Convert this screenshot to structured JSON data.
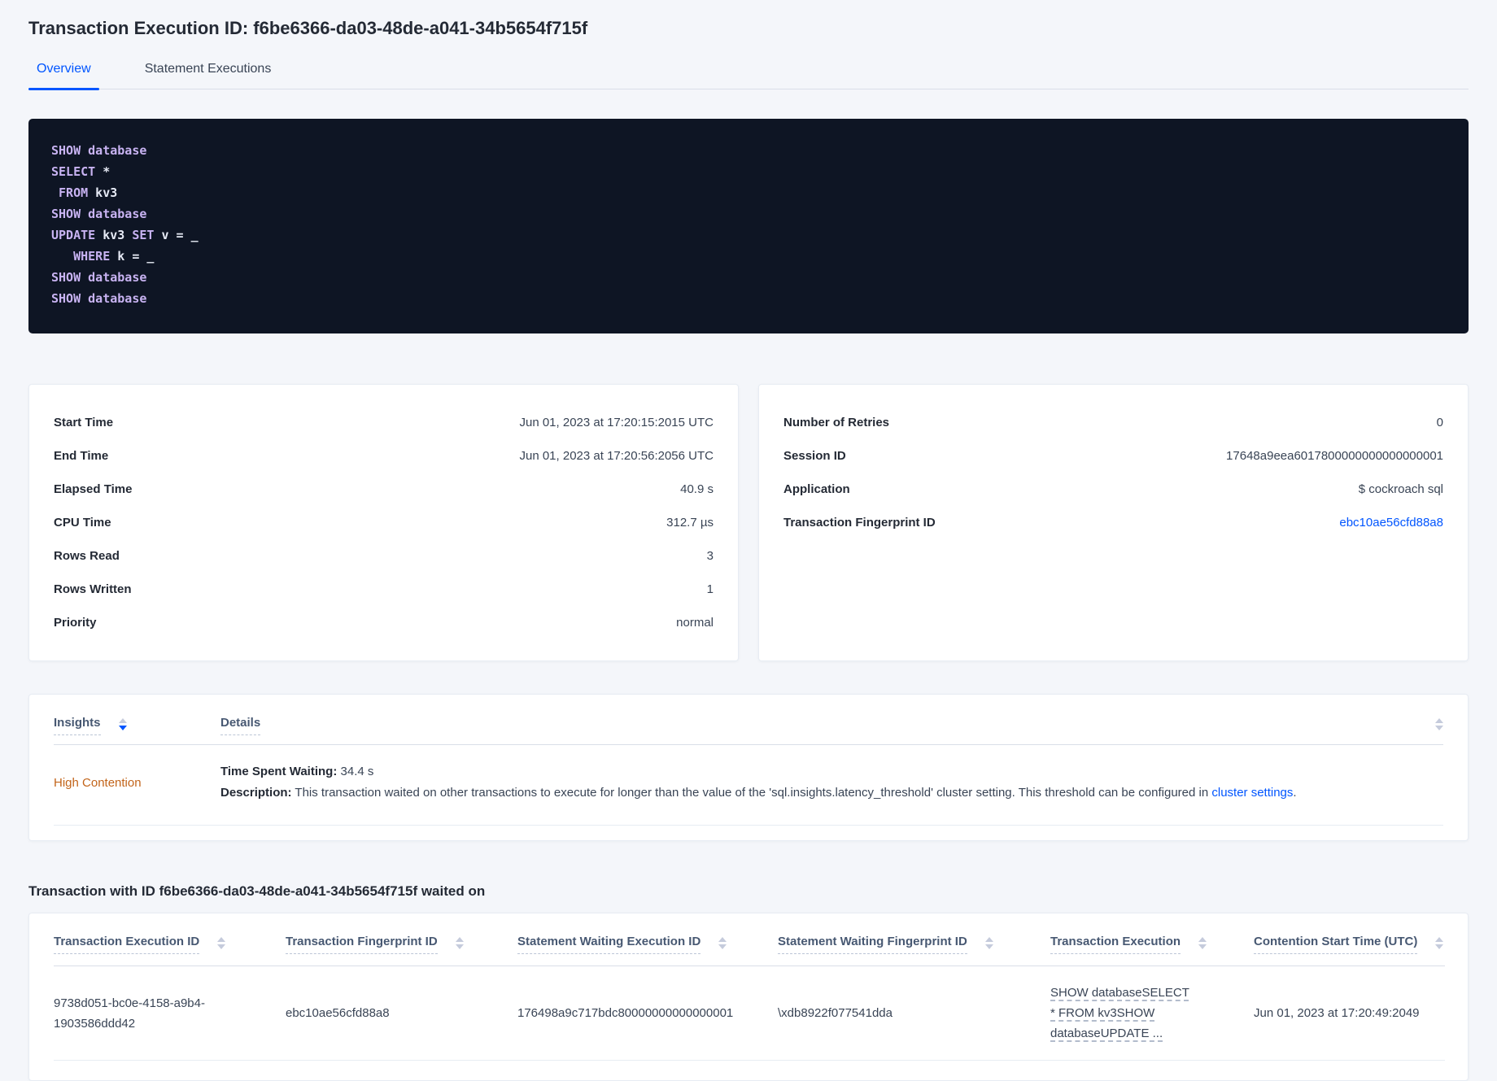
{
  "page": {
    "title": "Transaction Execution ID: f6be6366-da03-48de-a041-34b5654f715f"
  },
  "tabs": {
    "overview": "Overview",
    "statement_executions": "Statement Executions"
  },
  "sql": {
    "lines": [
      {
        "tokens": [
          {
            "text": "SHOW",
            "kw": true
          },
          {
            "text": " "
          },
          {
            "text": "database",
            "kw": true
          }
        ]
      },
      {
        "tokens": [
          {
            "text": "SELECT",
            "kw": true
          },
          {
            "text": " *"
          }
        ]
      },
      {
        "tokens": [
          {
            "text": " "
          },
          {
            "text": "FROM",
            "kw": true
          },
          {
            "text": " kv3"
          }
        ]
      },
      {
        "tokens": [
          {
            "text": "SHOW",
            "kw": true
          },
          {
            "text": " "
          },
          {
            "text": "database",
            "kw": true
          }
        ]
      },
      {
        "tokens": [
          {
            "text": "UPDATE",
            "kw": true
          },
          {
            "text": " kv3 "
          },
          {
            "text": "SET",
            "kw": true
          },
          {
            "text": " v = _"
          }
        ]
      },
      {
        "tokens": [
          {
            "text": "   "
          },
          {
            "text": "WHERE",
            "kw": true
          },
          {
            "text": " k = _"
          }
        ]
      },
      {
        "tokens": [
          {
            "text": "SHOW",
            "kw": true
          },
          {
            "text": " "
          },
          {
            "text": "database",
            "kw": true
          }
        ]
      },
      {
        "tokens": [
          {
            "text": "SHOW",
            "kw": true
          },
          {
            "text": " "
          },
          {
            "text": "database",
            "kw": true
          }
        ]
      }
    ]
  },
  "summary_left": {
    "rows": [
      {
        "label": "Start Time",
        "value": "Jun 01, 2023 at 17:20:15:2015 UTC"
      },
      {
        "label": "End Time",
        "value": "Jun 01, 2023 at 17:20:56:2056 UTC"
      },
      {
        "label": "Elapsed Time",
        "value": "40.9 s"
      },
      {
        "label": "CPU Time",
        "value": "312.7 µs"
      },
      {
        "label": "Rows Read",
        "value": "3"
      },
      {
        "label": "Rows Written",
        "value": "1"
      },
      {
        "label": "Priority",
        "value": "normal"
      }
    ]
  },
  "summary_right": {
    "rows": [
      {
        "label": "Number of Retries",
        "value": "0"
      },
      {
        "label": "Session ID",
        "value": "17648a9eea6017800000000000000001"
      },
      {
        "label": "Application",
        "value": "$ cockroach sql"
      },
      {
        "label": "Transaction Fingerprint ID",
        "value": "ebc10ae56cfd88a8"
      }
    ]
  },
  "insights": {
    "columns": {
      "insight": "Insights",
      "details": "Details"
    },
    "row": {
      "insight": "High Contention",
      "waiting_label": "Time Spent Waiting:",
      "waiting_value": " 34.4 s",
      "description_label": "Description:",
      "description_text": " This transaction waited on other transactions to execute for longer than the value of the 'sql.insights.latency_threshold' cluster setting. This threshold can be configured in ",
      "description_link": "cluster settings",
      "description_end": "."
    }
  },
  "waited": {
    "heading": "Transaction with ID f6be6366-da03-48de-a041-34b5654f715f waited on",
    "columns": [
      "Transaction Execution ID",
      "Transaction Fingerprint ID",
      "Statement Waiting Execution ID",
      "Statement Waiting Fingerprint ID",
      "Transaction Execution",
      "Contention Start Time (UTC)"
    ],
    "row": {
      "transaction_execution_id": "9738d051-bc0e-4158-a9b4-1903586ddd42",
      "transaction_fingerprint_id": "ebc10ae56cfd88a8",
      "statement_waiting_execution_id": "176498a9c717bdc80000000000000001",
      "statement_waiting_fingerprint_id": "\\xdb8922f077541dda",
      "transaction_execution": "SHOW databaseSELECT * FROM kv3SHOW databaseUPDATE ...",
      "contention_start_time": "Jun 01, 2023 at 17:20:49:2049"
    }
  },
  "colors": {
    "accent_blue": "#0055ff",
    "warning_orange": "#c2641a",
    "code_keyword": "#c8b3f2",
    "code_background": "#0e1524"
  }
}
